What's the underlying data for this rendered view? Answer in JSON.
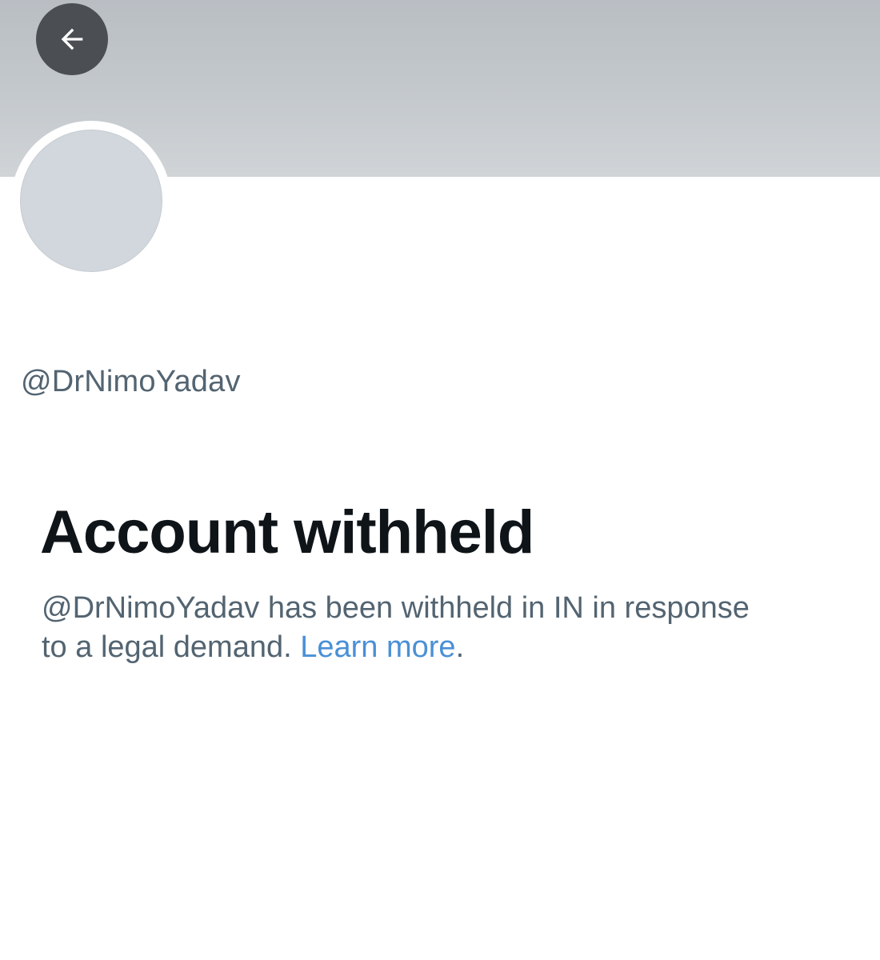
{
  "header": {
    "back_icon": "arrow-left-icon",
    "banner_color": "#c4c9cd",
    "back_button_color": "#4b4f53"
  },
  "profile": {
    "handle": "@DrNimoYadav",
    "avatar_color": "#d1d7dc"
  },
  "notice": {
    "title": "Account withheld",
    "message_line1": "@DrNimoYadav has been withheld in IN in response",
    "message_line2": "to a legal demand.",
    "learn_more_label": "Learn more",
    "trailing_punctuation": ".",
    "link_color": "#4a90d6",
    "text_color": "#536471"
  }
}
